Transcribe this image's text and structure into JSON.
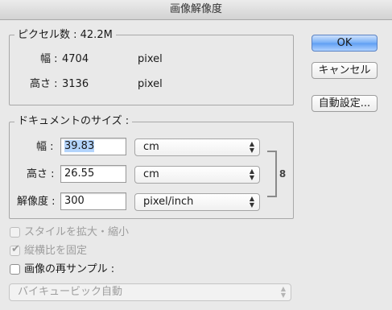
{
  "window": {
    "title": "画像解像度"
  },
  "pixel_dimensions": {
    "title": "ピクセル数 : 42.2M",
    "width": {
      "label": "幅 :",
      "value": "4704",
      "unit": "pixel"
    },
    "height": {
      "label": "高さ :",
      "value": "3136",
      "unit": "pixel"
    }
  },
  "document_size": {
    "title": "ドキュメントのサイズ :",
    "width": {
      "label": "幅 :",
      "value": "39.83",
      "unit": "cm"
    },
    "height": {
      "label": "高さ :",
      "value": "26.55",
      "unit": "cm"
    },
    "resolution": {
      "label": "解像度 :",
      "value": "300",
      "unit": "pixel/inch"
    },
    "link_icon": "chain-link-icon"
  },
  "options": {
    "scale_styles": {
      "label": "スタイルを拡大・縮小",
      "checked": false,
      "enabled": false
    },
    "constrain_proportions": {
      "label": "縦横比を固定",
      "checked": true,
      "enabled": false
    },
    "resample": {
      "label": "画像の再サンプル :",
      "checked": false,
      "enabled": true
    },
    "resample_method": {
      "value": "バイキュービック自動",
      "enabled": false
    }
  },
  "buttons": {
    "ok": "OK",
    "cancel": "キャンセル",
    "auto": "自動設定..."
  }
}
